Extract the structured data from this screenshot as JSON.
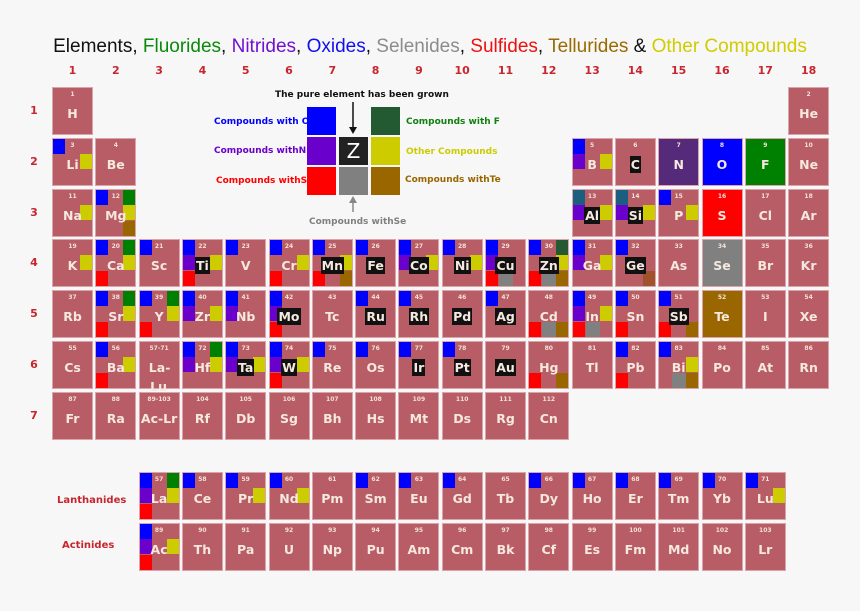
{
  "title": [
    {
      "text": "Elements",
      "color": "#111111"
    },
    {
      "text": ", ",
      "color": "#111111"
    },
    {
      "text": "Fluorides",
      "color": "#0a8a0a"
    },
    {
      "text": ", ",
      "color": "#111111"
    },
    {
      "text": "Nitrides",
      "color": "#7010d0"
    },
    {
      "text": ", ",
      "color": "#111111"
    },
    {
      "text": "Oxides",
      "color": "#1010ee"
    },
    {
      "text": ", ",
      "color": "#111111"
    },
    {
      "text": "Selenides",
      "color": "#8c8c8c"
    },
    {
      "text": ", ",
      "color": "#111111"
    },
    {
      "text": "Sulfides",
      "color": "#ee1010"
    },
    {
      "text": ", ",
      "color": "#111111"
    },
    {
      "text": "Tellurides",
      "color": "#9a6a00"
    },
    {
      "text": " & ",
      "color": "#111111"
    },
    {
      "text": "Other Compounds",
      "color": "#d0cc00"
    }
  ],
  "groups": [
    "1",
    "2",
    "3",
    "4",
    "5",
    "6",
    "7",
    "8",
    "9",
    "10",
    "11",
    "12",
    "13",
    "14",
    "15",
    "16",
    "17",
    "18"
  ],
  "periods": [
    "1",
    "2",
    "3",
    "4",
    "5",
    "6",
    "7"
  ],
  "marker_colors": {
    "O": "#0000ff",
    "N": "#6a00cc",
    "S": "#ff0000",
    "F": "#008000",
    "Fd": "#235a31",
    "X": "#cccc00",
    "T": "#996600",
    "Tg": "#a0522d",
    "E": "#808080",
    "Ot": "#1a5e80"
  },
  "full_colors": {
    "N": "#552a7a",
    "O": "#0000ff",
    "F": "#008000",
    "S": "#ff0000",
    "Se": "#808080",
    "Te": "#996600"
  },
  "legend": {
    "heading": "The pure element has been grown",
    "center_symbol": "Z",
    "items": [
      {
        "key": "O",
        "label": "Compounds with O",
        "color": "#0000ff"
      },
      {
        "key": "N",
        "label": "Compounds withN",
        "color": "#6a00cc"
      },
      {
        "key": "S",
        "label": "Compounds withS",
        "color": "#ff0000"
      },
      {
        "key": "F",
        "label": "Compounds with F",
        "color": "#235a31",
        "text_color": "#108010"
      },
      {
        "key": "X",
        "label": "Other Compounds",
        "color": "#cccc00"
      },
      {
        "key": "T",
        "label": "Compounds withTe",
        "color": "#996600"
      },
      {
        "key": "E",
        "label": "Compounds withSe",
        "color": "#808080"
      }
    ]
  },
  "series_labels": {
    "lanthanides": "Lanthanides",
    "actinides": "Actinides"
  },
  "elements": [
    {
      "s": "H",
      "n": "1",
      "g": 1,
      "p": 1
    },
    {
      "s": "He",
      "n": "2",
      "g": 18,
      "p": 1
    },
    {
      "s": "Li",
      "n": "3",
      "g": 1,
      "p": 2,
      "m": [
        "O",
        "X"
      ]
    },
    {
      "s": "Be",
      "n": "4",
      "g": 2,
      "p": 2
    },
    {
      "s": "B",
      "n": "5",
      "g": 13,
      "p": 2,
      "m": [
        "O",
        "N",
        "X"
      ]
    },
    {
      "s": "C",
      "n": "6",
      "g": 14,
      "p": 2,
      "grown": true
    },
    {
      "s": "N",
      "n": "7",
      "g": 15,
      "p": 2,
      "full": "N"
    },
    {
      "s": "O",
      "n": "8",
      "g": 16,
      "p": 2,
      "full": "O"
    },
    {
      "s": "F",
      "n": "9",
      "g": 17,
      "p": 2,
      "full": "F"
    },
    {
      "s": "Ne",
      "n": "10",
      "g": 18,
      "p": 2
    },
    {
      "s": "Na",
      "n": "11",
      "g": 1,
      "p": 3,
      "m": [
        "X"
      ]
    },
    {
      "s": "Mg",
      "n": "12",
      "g": 2,
      "p": 3,
      "m": [
        "O",
        "F",
        "X",
        "T"
      ]
    },
    {
      "s": "Al",
      "n": "13",
      "g": 13,
      "p": 3,
      "m": [
        "Ot",
        "N",
        "X"
      ],
      "grown": true
    },
    {
      "s": "Si",
      "n": "14",
      "g": 14,
      "p": 3,
      "m": [
        "Ot",
        "N",
        "X"
      ],
      "grown": true
    },
    {
      "s": "P",
      "n": "15",
      "g": 15,
      "p": 3,
      "m": [
        "O",
        "X"
      ]
    },
    {
      "s": "S",
      "n": "16",
      "g": 16,
      "p": 3,
      "full": "S"
    },
    {
      "s": "Cl",
      "n": "17",
      "g": 17,
      "p": 3
    },
    {
      "s": "Ar",
      "n": "18",
      "g": 18,
      "p": 3
    },
    {
      "s": "K",
      "n": "19",
      "g": 1,
      "p": 4,
      "m": [
        "X"
      ]
    },
    {
      "s": "Ca",
      "n": "20",
      "g": 2,
      "p": 4,
      "m": [
        "O",
        "F",
        "X",
        "S"
      ]
    },
    {
      "s": "Sc",
      "n": "21",
      "g": 3,
      "p": 4,
      "m": [
        "O"
      ]
    },
    {
      "s": "Ti",
      "n": "22",
      "g": 4,
      "p": 4,
      "m": [
        "O",
        "N",
        "X",
        "S"
      ],
      "grown": true
    },
    {
      "s": "V",
      "n": "23",
      "g": 5,
      "p": 4,
      "m": [
        "O"
      ]
    },
    {
      "s": "Cr",
      "n": "24",
      "g": 6,
      "p": 4,
      "m": [
        "O",
        "X",
        "S"
      ]
    },
    {
      "s": "Mn",
      "n": "25",
      "g": 7,
      "p": 4,
      "m": [
        "O",
        "X",
        "S",
        "T"
      ],
      "grown": true
    },
    {
      "s": "Fe",
      "n": "26",
      "g": 8,
      "p": 4,
      "m": [
        "O"
      ],
      "grown": true
    },
    {
      "s": "Co",
      "n": "27",
      "g": 9,
      "p": 4,
      "m": [
        "O",
        "N",
        "X"
      ],
      "grown": true
    },
    {
      "s": "Ni",
      "n": "28",
      "g": 10,
      "p": 4,
      "m": [
        "O",
        "X"
      ],
      "grown": true
    },
    {
      "s": "Cu",
      "n": "29",
      "g": 11,
      "p": 4,
      "m": [
        "O",
        "N",
        "S",
        "E"
      ],
      "grown": true
    },
    {
      "s": "Zn",
      "n": "30",
      "g": 12,
      "p": 4,
      "m": [
        "O",
        "Fd",
        "X",
        "S",
        "E",
        "T"
      ],
      "grown": true
    },
    {
      "s": "Ga",
      "n": "31",
      "g": 13,
      "p": 4,
      "m": [
        "O",
        "N",
        "X"
      ]
    },
    {
      "s": "Ge",
      "n": "32",
      "g": 14,
      "p": 4,
      "m": [
        "O",
        "Tg"
      ],
      "grown": true
    },
    {
      "s": "As",
      "n": "33",
      "g": 15,
      "p": 4
    },
    {
      "s": "Se",
      "n": "34",
      "g": 16,
      "p": 4,
      "full": "Se"
    },
    {
      "s": "Br",
      "n": "35",
      "g": 17,
      "p": 4
    },
    {
      "s": "Kr",
      "n": "36",
      "g": 18,
      "p": 4
    },
    {
      "s": "Rb",
      "n": "37",
      "g": 1,
      "p": 5
    },
    {
      "s": "Sr",
      "n": "38",
      "g": 2,
      "p": 5,
      "m": [
        "O",
        "F",
        "X",
        "S"
      ]
    },
    {
      "s": "Y",
      "n": "39",
      "g": 3,
      "p": 5,
      "m": [
        "O",
        "F",
        "X",
        "S"
      ]
    },
    {
      "s": "Zr",
      "n": "40",
      "g": 4,
      "p": 5,
      "m": [
        "O",
        "N",
        "X"
      ]
    },
    {
      "s": "Nb",
      "n": "41",
      "g": 5,
      "p": 5,
      "m": [
        "O",
        "N"
      ]
    },
    {
      "s": "Mo",
      "n": "42",
      "g": 6,
      "p": 5,
      "m": [
        "O",
        "N",
        "S"
      ],
      "grown": true
    },
    {
      "s": "Tc",
      "n": "43",
      "g": 7,
      "p": 5
    },
    {
      "s": "Ru",
      "n": "44",
      "g": 8,
      "p": 5,
      "m": [
        "O"
      ],
      "grown": true
    },
    {
      "s": "Rh",
      "n": "45",
      "g": 9,
      "p": 5,
      "m": [
        "O"
      ],
      "grown": true
    },
    {
      "s": "Pd",
      "n": "46",
      "g": 10,
      "p": 5,
      "grown": true
    },
    {
      "s": "Ag",
      "n": "47",
      "g": 11,
      "p": 5,
      "m": [
        "O"
      ],
      "grown": true
    },
    {
      "s": "Cd",
      "n": "48",
      "g": 12,
      "p": 5,
      "m": [
        "S",
        "E",
        "T"
      ]
    },
    {
      "s": "In",
      "n": "49",
      "g": 13,
      "p": 5,
      "m": [
        "O",
        "N",
        "X",
        "S",
        "E"
      ]
    },
    {
      "s": "Sn",
      "n": "50",
      "g": 14,
      "p": 5,
      "m": [
        "O",
        "S"
      ]
    },
    {
      "s": "Sb",
      "n": "51",
      "g": 15,
      "p": 5,
      "m": [
        "O",
        "S",
        "T"
      ],
      "grown": true
    },
    {
      "s": "Te",
      "n": "52",
      "g": 16,
      "p": 5,
      "full": "Te"
    },
    {
      "s": "I",
      "n": "53",
      "g": 17,
      "p": 5
    },
    {
      "s": "Xe",
      "n": "54",
      "g": 18,
      "p": 5
    },
    {
      "s": "Cs",
      "n": "55",
      "g": 1,
      "p": 6
    },
    {
      "s": "Ba",
      "n": "56",
      "g": 2,
      "p": 6,
      "m": [
        "O",
        "X",
        "S"
      ]
    },
    {
      "s": "La-Lu",
      "n": "57-71",
      "g": 3,
      "p": 6
    },
    {
      "s": "Hf",
      "n": "72",
      "g": 4,
      "p": 6,
      "m": [
        "O",
        "N",
        "F",
        "X"
      ]
    },
    {
      "s": "Ta",
      "n": "73",
      "g": 5,
      "p": 6,
      "m": [
        "O",
        "N",
        "X"
      ],
      "grown": true
    },
    {
      "s": "W",
      "n": "74",
      "g": 6,
      "p": 6,
      "m": [
        "O",
        "N",
        "X",
        "S"
      ],
      "grown": true
    },
    {
      "s": "Re",
      "n": "75",
      "g": 7,
      "p": 6,
      "m": [
        "O"
      ]
    },
    {
      "s": "Os",
      "n": "76",
      "g": 8,
      "p": 6,
      "m": [
        "O"
      ]
    },
    {
      "s": "Ir",
      "n": "77",
      "g": 9,
      "p": 6,
      "m": [
        "O"
      ],
      "grown": true
    },
    {
      "s": "Pt",
      "n": "78",
      "g": 10,
      "p": 6,
      "m": [
        "O"
      ],
      "grown": true
    },
    {
      "s": "Au",
      "n": "79",
      "g": 11,
      "p": 6,
      "grown": true
    },
    {
      "s": "Hg",
      "n": "80",
      "g": 12,
      "p": 6,
      "m": [
        "S",
        "T"
      ]
    },
    {
      "s": "Tl",
      "n": "81",
      "g": 13,
      "p": 6
    },
    {
      "s": "Pb",
      "n": "82",
      "g": 14,
      "p": 6,
      "m": [
        "O",
        "S"
      ]
    },
    {
      "s": "Bi",
      "n": "83",
      "g": 15,
      "p": 6,
      "m": [
        "O",
        "X",
        "E",
        "T"
      ]
    },
    {
      "s": "Po",
      "n": "84",
      "g": 16,
      "p": 6
    },
    {
      "s": "At",
      "n": "85",
      "g": 17,
      "p": 6
    },
    {
      "s": "Rn",
      "n": "86",
      "g": 18,
      "p": 6
    },
    {
      "s": "Fr",
      "n": "87",
      "g": 1,
      "p": 7
    },
    {
      "s": "Ra",
      "n": "88",
      "g": 2,
      "p": 7
    },
    {
      "s": "Ac-Lr",
      "n": "89-103",
      "g": 3,
      "p": 7
    },
    {
      "s": "Rf",
      "n": "104",
      "g": 4,
      "p": 7
    },
    {
      "s": "Db",
      "n": "105",
      "g": 5,
      "p": 7
    },
    {
      "s": "Sg",
      "n": "106",
      "g": 6,
      "p": 7
    },
    {
      "s": "Bh",
      "n": "107",
      "g": 7,
      "p": 7
    },
    {
      "s": "Hs",
      "n": "108",
      "g": 8,
      "p": 7
    },
    {
      "s": "Mt",
      "n": "109",
      "g": 9,
      "p": 7
    },
    {
      "s": "Ds",
      "n": "110",
      "g": 10,
      "p": 7
    },
    {
      "s": "Rg",
      "n": "111",
      "g": 11,
      "p": 7
    },
    {
      "s": "Cn",
      "n": "112",
      "g": 12,
      "p": 7
    }
  ],
  "lanthanides": [
    {
      "s": "La",
      "n": "57",
      "m": [
        "O",
        "N",
        "S",
        "F",
        "X"
      ]
    },
    {
      "s": "Ce",
      "n": "58",
      "m": [
        "O"
      ]
    },
    {
      "s": "Pr",
      "n": "59",
      "m": [
        "O",
        "X"
      ]
    },
    {
      "s": "Nd",
      "n": "60",
      "m": [
        "O",
        "X"
      ]
    },
    {
      "s": "Pm",
      "n": "61"
    },
    {
      "s": "Sm",
      "n": "62",
      "m": [
        "O"
      ]
    },
    {
      "s": "Eu",
      "n": "63",
      "m": [
        "O"
      ]
    },
    {
      "s": "Gd",
      "n": "64",
      "m": [
        "O"
      ]
    },
    {
      "s": "Tb",
      "n": "65"
    },
    {
      "s": "Dy",
      "n": "66",
      "m": [
        "O"
      ]
    },
    {
      "s": "Ho",
      "n": "67",
      "m": [
        "O"
      ]
    },
    {
      "s": "Er",
      "n": "68",
      "m": [
        "O"
      ]
    },
    {
      "s": "Tm",
      "n": "69",
      "m": [
        "O"
      ]
    },
    {
      "s": "Yb",
      "n": "70",
      "m": [
        "O"
      ]
    },
    {
      "s": "Lu",
      "n": "71",
      "m": [
        "O",
        "X"
      ]
    }
  ],
  "actinides": [
    {
      "s": "Ac",
      "n": "89",
      "m": [
        "O",
        "N",
        "S",
        "X"
      ]
    },
    {
      "s": "Th",
      "n": "90"
    },
    {
      "s": "Pa",
      "n": "91"
    },
    {
      "s": "U",
      "n": "92"
    },
    {
      "s": "Np",
      "n": "93"
    },
    {
      "s": "Pu",
      "n": "94"
    },
    {
      "s": "Am",
      "n": "95"
    },
    {
      "s": "Cm",
      "n": "96"
    },
    {
      "s": "Bk",
      "n": "97"
    },
    {
      "s": "Cf",
      "n": "98"
    },
    {
      "s": "Es",
      "n": "99"
    },
    {
      "s": "Fm",
      "n": "100"
    },
    {
      "s": "Md",
      "n": "101"
    },
    {
      "s": "No",
      "n": "102"
    },
    {
      "s": "Lr",
      "n": "103"
    }
  ]
}
